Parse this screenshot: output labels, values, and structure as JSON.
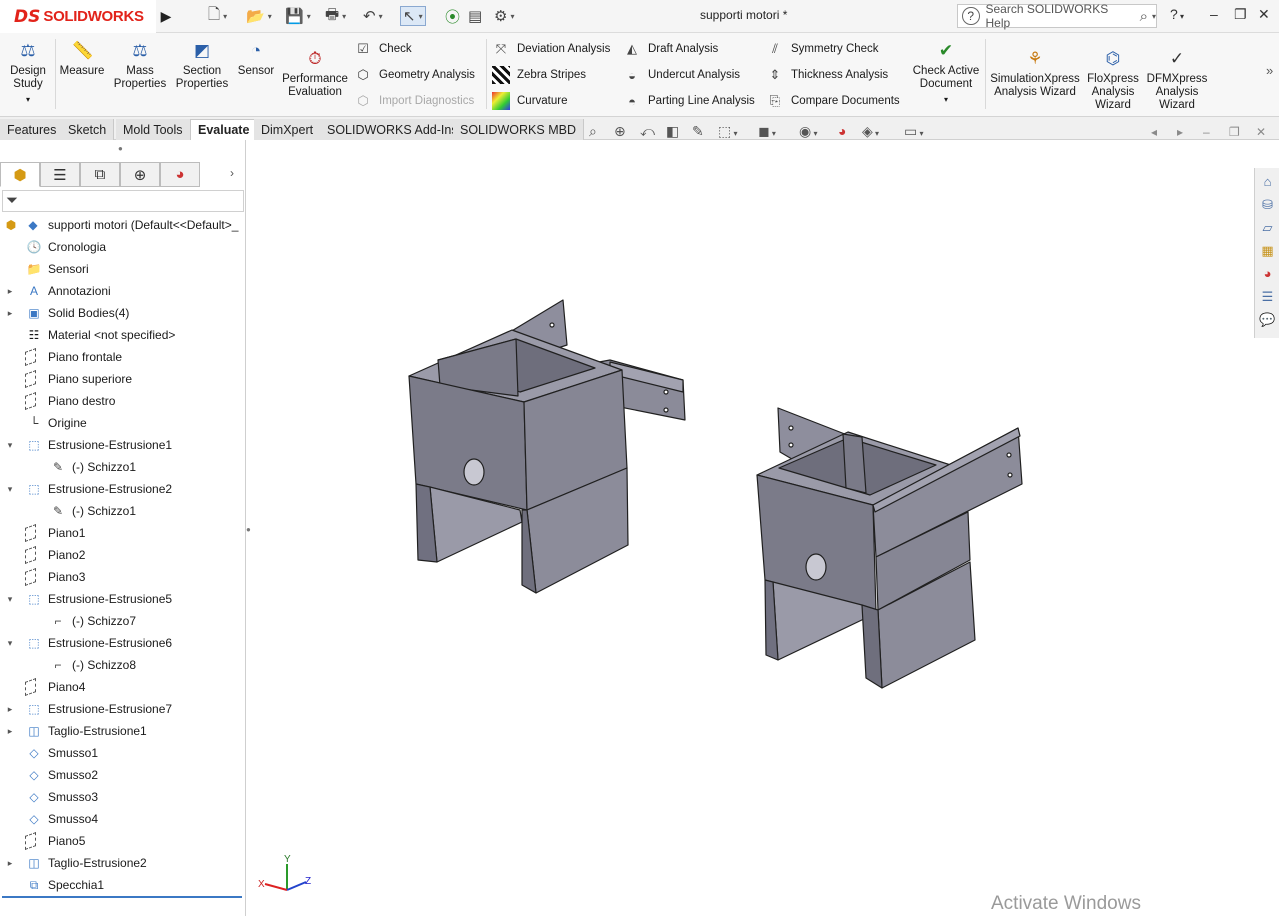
{
  "app": {
    "logo_prefix": "DS",
    "logo_text": "SOLIDWORKS",
    "document_title": "supporti motori *"
  },
  "search": {
    "placeholder": "Search SOLIDWORKS Help"
  },
  "ribbon": {
    "design_study": "Design Study",
    "measure": "Measure",
    "mass_properties": "Mass Properties",
    "section_properties": "Section Properties",
    "sensor": "Sensor",
    "performance_evaluation": "Performance Evaluation",
    "check": "Check",
    "geometry_analysis": "Geometry Analysis",
    "import_diagnostics": "Import Diagnostics",
    "deviation_analysis": "Deviation Analysis",
    "zebra_stripes": "Zebra Stripes",
    "curvature": "Curvature",
    "draft_analysis": "Draft Analysis",
    "undercut_analysis": "Undercut Analysis",
    "parting_line_analysis": "Parting Line Analysis",
    "symmetry_check": "Symmetry Check",
    "thickness_analysis": "Thickness Analysis",
    "compare_documents": "Compare Documents",
    "check_active_document": "Check Active Document",
    "simulationxpress": "SimulationXpress Analysis Wizard",
    "floxpress": "FloXpress Analysis Wizard",
    "dfmxpress": "DFMXpress Analysis Wizard"
  },
  "tabs": [
    "Features",
    "Sketch",
    "Mold Tools",
    "Evaluate",
    "DimXpert",
    "SOLIDWORKS Add-Ins",
    "SOLIDWORKS MBD"
  ],
  "tree": {
    "root": "supporti motori  (Default<<Default>_",
    "items": [
      "Cronologia",
      "Sensori",
      "Annotazioni",
      "Solid Bodies(4)",
      "Material <not specified>",
      "Piano frontale",
      "Piano superiore",
      "Piano destro",
      "Origine",
      "Estrusione-Estrusione1",
      "(-) Schizzo1",
      "Estrusione-Estrusione2",
      "(-) Schizzo1",
      "Piano1",
      "Piano2",
      "Piano3",
      "Estrusione-Estrusione5",
      "(-) Schizzo7",
      "Estrusione-Estrusione6",
      "(-) Schizzo8",
      "Piano4",
      "Estrusione-Estrusione7",
      "Taglio-Estrusione1",
      "Smusso1",
      "Smusso2",
      "Smusso3",
      "Smusso4",
      "Piano5",
      "Taglio-Estrusione2",
      "Specchia1"
    ]
  },
  "triad": {
    "x": "X",
    "y": "Y",
    "z": "Z"
  },
  "watermark": "Activate Windows",
  "colors": {
    "model_face": "#8a8a99",
    "model_light": "#9c9cab",
    "model_dark": "#70707e",
    "brand_red": "#e2231a"
  }
}
